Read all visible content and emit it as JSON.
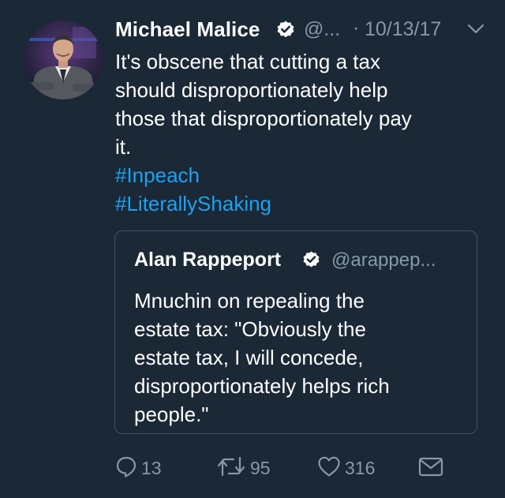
{
  "tweet": {
    "author": {
      "display_name": "Michael Malice",
      "handle": "@...",
      "verified": true
    },
    "separator": "·",
    "timestamp": "10/13/17",
    "text_lines": [
      "It's obscene that cutting a tax",
      "should disproportionately help",
      "those that disproportionately pay",
      "it."
    ],
    "hashtags": [
      "#Inpeach",
      "#LiterallyShaking"
    ],
    "quoted_tweet": {
      "display_name": "Alan Rappeport",
      "handle": "@arappep...",
      "verified": true,
      "text_lines": [
        "Mnuchin on repealing the",
        "estate tax: \"Obviously the",
        "estate tax, I will concede,",
        "disproportionately helps rich",
        "people.\""
      ]
    },
    "actions": {
      "replies": "13",
      "retweets": "95",
      "likes": "316"
    }
  },
  "colors": {
    "background": "#1b2836",
    "text": "#ffffff",
    "muted": "#8899a6",
    "link": "#1da1f2",
    "border": "#3d5466"
  },
  "icons": {
    "verified": "verified-badge-icon",
    "caret": "chevron-down-icon",
    "reply": "reply-icon",
    "retweet": "retweet-icon",
    "like": "heart-icon",
    "dm": "envelope-icon"
  }
}
